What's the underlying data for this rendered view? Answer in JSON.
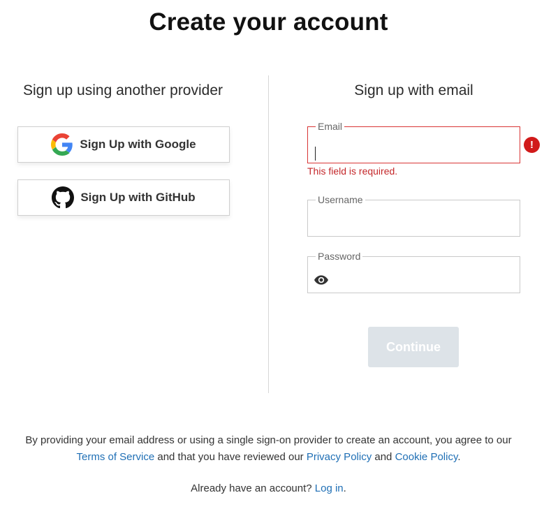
{
  "title": "Create your account",
  "left": {
    "heading": "Sign up using another provider",
    "google_label": "Sign Up with Google",
    "github_label": "Sign Up with GitHub"
  },
  "right": {
    "heading": "Sign up with email",
    "email": {
      "label": "Email",
      "value": "",
      "error": "This field is required.",
      "error_icon": "!"
    },
    "username": {
      "label": "Username",
      "value": ""
    },
    "password": {
      "label": "Password",
      "value": ""
    },
    "continue_label": "Continue"
  },
  "footer": {
    "text_1": "By providing your email address or using a single sign-on provider to create an account, you agree to our",
    "terms_link": "Terms of Service",
    "text_2": "and that you have reviewed our",
    "privacy_link": "Privacy Policy",
    "text_3": "and",
    "cookie_link": "Cookie Policy",
    "text_4": ".",
    "login_prompt": "Already have an account?",
    "login_link": "Log in",
    "login_end": "."
  },
  "colors": {
    "error": "#d93434",
    "link": "#1f6fb5",
    "button_disabled": "#dde3e8"
  },
  "icons": {
    "google": "google-icon",
    "github": "github-icon",
    "eye": "eye-icon",
    "error": "error-icon"
  }
}
